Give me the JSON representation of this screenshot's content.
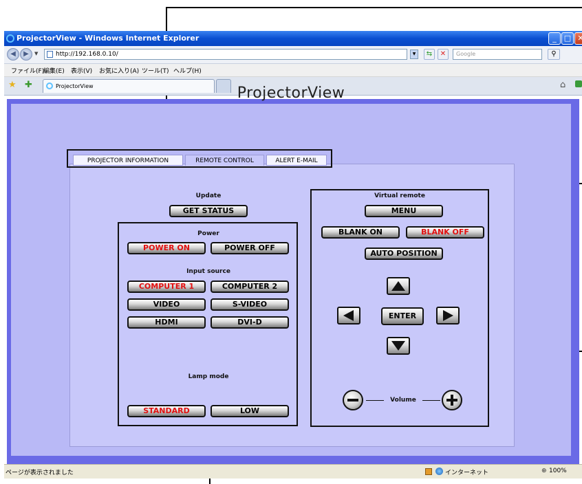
{
  "window": {
    "title": "ProjectorView - Windows Internet Explorer",
    "url": "http://192.168.0.10/",
    "search_placeholder": "Google",
    "menu": [
      "ファイル(F)",
      "編集(E)",
      "表示(V)",
      "お気に入り(A)",
      "ツール(T)",
      "ヘルプ(H)"
    ],
    "tab_label": "ProjectorView",
    "status_text": "ページが表示されました",
    "zone_text": "インターネット",
    "zoom": "100%"
  },
  "page": {
    "title": "ProjectorView",
    "tabs": [
      "PROJECTOR INFORMATION",
      "REMOTE CONTROL",
      "ALERT E-MAIL"
    ],
    "active_tab": "REMOTE CONTROL",
    "update": {
      "label": "Update",
      "button": "GET STATUS"
    },
    "power": {
      "label": "Power",
      "on": "POWER ON",
      "off": "POWER OFF"
    },
    "input": {
      "label": "Input source",
      "computer1": "COMPUTER 1",
      "computer2": "COMPUTER 2",
      "video": "VIDEO",
      "svideo": "S-VIDEO",
      "hdmi": "HDMI",
      "dvid": "DVI-D"
    },
    "lamp": {
      "label": "Lamp mode",
      "standard": "STANDARD",
      "low": "LOW"
    },
    "remote": {
      "label": "Virtual remote",
      "menu": "MENU",
      "blank_on": "BLANK ON",
      "blank_off": "BLANK OFF",
      "auto_position": "AUTO POSITION",
      "enter": "ENTER",
      "volume": "Volume"
    }
  },
  "colors": {
    "active_red": "#e21010",
    "page_border": "#6a6ae6",
    "page_bg": "#b9b9f6",
    "panel_bg": "#c8c8fa"
  }
}
